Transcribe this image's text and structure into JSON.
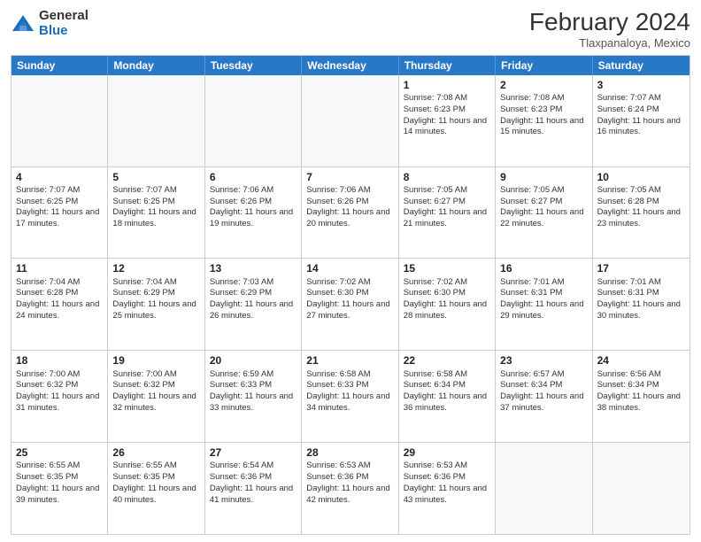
{
  "logo": {
    "general": "General",
    "blue": "Blue"
  },
  "title": "February 2024",
  "subtitle": "Tlaxpanaloya, Mexico",
  "header_days": [
    "Sunday",
    "Monday",
    "Tuesday",
    "Wednesday",
    "Thursday",
    "Friday",
    "Saturday"
  ],
  "weeks": [
    [
      {
        "day": "",
        "info": ""
      },
      {
        "day": "",
        "info": ""
      },
      {
        "day": "",
        "info": ""
      },
      {
        "day": "",
        "info": ""
      },
      {
        "day": "1",
        "info": "Sunrise: 7:08 AM\nSunset: 6:23 PM\nDaylight: 11 hours and 14 minutes."
      },
      {
        "day": "2",
        "info": "Sunrise: 7:08 AM\nSunset: 6:23 PM\nDaylight: 11 hours and 15 minutes."
      },
      {
        "day": "3",
        "info": "Sunrise: 7:07 AM\nSunset: 6:24 PM\nDaylight: 11 hours and 16 minutes."
      }
    ],
    [
      {
        "day": "4",
        "info": "Sunrise: 7:07 AM\nSunset: 6:25 PM\nDaylight: 11 hours and 17 minutes."
      },
      {
        "day": "5",
        "info": "Sunrise: 7:07 AM\nSunset: 6:25 PM\nDaylight: 11 hours and 18 minutes."
      },
      {
        "day": "6",
        "info": "Sunrise: 7:06 AM\nSunset: 6:26 PM\nDaylight: 11 hours and 19 minutes."
      },
      {
        "day": "7",
        "info": "Sunrise: 7:06 AM\nSunset: 6:26 PM\nDaylight: 11 hours and 20 minutes."
      },
      {
        "day": "8",
        "info": "Sunrise: 7:05 AM\nSunset: 6:27 PM\nDaylight: 11 hours and 21 minutes."
      },
      {
        "day": "9",
        "info": "Sunrise: 7:05 AM\nSunset: 6:27 PM\nDaylight: 11 hours and 22 minutes."
      },
      {
        "day": "10",
        "info": "Sunrise: 7:05 AM\nSunset: 6:28 PM\nDaylight: 11 hours and 23 minutes."
      }
    ],
    [
      {
        "day": "11",
        "info": "Sunrise: 7:04 AM\nSunset: 6:28 PM\nDaylight: 11 hours and 24 minutes."
      },
      {
        "day": "12",
        "info": "Sunrise: 7:04 AM\nSunset: 6:29 PM\nDaylight: 11 hours and 25 minutes."
      },
      {
        "day": "13",
        "info": "Sunrise: 7:03 AM\nSunset: 6:29 PM\nDaylight: 11 hours and 26 minutes."
      },
      {
        "day": "14",
        "info": "Sunrise: 7:02 AM\nSunset: 6:30 PM\nDaylight: 11 hours and 27 minutes."
      },
      {
        "day": "15",
        "info": "Sunrise: 7:02 AM\nSunset: 6:30 PM\nDaylight: 11 hours and 28 minutes."
      },
      {
        "day": "16",
        "info": "Sunrise: 7:01 AM\nSunset: 6:31 PM\nDaylight: 11 hours and 29 minutes."
      },
      {
        "day": "17",
        "info": "Sunrise: 7:01 AM\nSunset: 6:31 PM\nDaylight: 11 hours and 30 minutes."
      }
    ],
    [
      {
        "day": "18",
        "info": "Sunrise: 7:00 AM\nSunset: 6:32 PM\nDaylight: 11 hours and 31 minutes."
      },
      {
        "day": "19",
        "info": "Sunrise: 7:00 AM\nSunset: 6:32 PM\nDaylight: 11 hours and 32 minutes."
      },
      {
        "day": "20",
        "info": "Sunrise: 6:59 AM\nSunset: 6:33 PM\nDaylight: 11 hours and 33 minutes."
      },
      {
        "day": "21",
        "info": "Sunrise: 6:58 AM\nSunset: 6:33 PM\nDaylight: 11 hours and 34 minutes."
      },
      {
        "day": "22",
        "info": "Sunrise: 6:58 AM\nSunset: 6:34 PM\nDaylight: 11 hours and 36 minutes."
      },
      {
        "day": "23",
        "info": "Sunrise: 6:57 AM\nSunset: 6:34 PM\nDaylight: 11 hours and 37 minutes."
      },
      {
        "day": "24",
        "info": "Sunrise: 6:56 AM\nSunset: 6:34 PM\nDaylight: 11 hours and 38 minutes."
      }
    ],
    [
      {
        "day": "25",
        "info": "Sunrise: 6:55 AM\nSunset: 6:35 PM\nDaylight: 11 hours and 39 minutes."
      },
      {
        "day": "26",
        "info": "Sunrise: 6:55 AM\nSunset: 6:35 PM\nDaylight: 11 hours and 40 minutes."
      },
      {
        "day": "27",
        "info": "Sunrise: 6:54 AM\nSunset: 6:36 PM\nDaylight: 11 hours and 41 minutes."
      },
      {
        "day": "28",
        "info": "Sunrise: 6:53 AM\nSunset: 6:36 PM\nDaylight: 11 hours and 42 minutes."
      },
      {
        "day": "29",
        "info": "Sunrise: 6:53 AM\nSunset: 6:36 PM\nDaylight: 11 hours and 43 minutes."
      },
      {
        "day": "",
        "info": ""
      },
      {
        "day": "",
        "info": ""
      }
    ]
  ]
}
